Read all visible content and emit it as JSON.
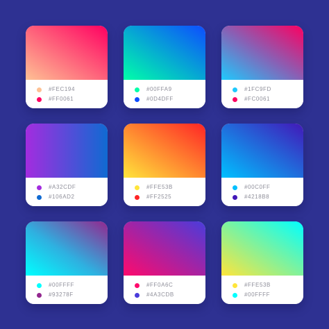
{
  "background": "#2E3192",
  "cards": [
    {
      "colors": [
        {
          "hex": "#FEC194",
          "label": "#FEC194"
        },
        {
          "hex": "#FF0061",
          "label": "#FF0061"
        }
      ],
      "gradient_direction": "top-right to bottom-left"
    },
    {
      "colors": [
        {
          "hex": "#00FFA9",
          "label": "#00FFA9"
        },
        {
          "hex": "#0D4DFF",
          "label": "#0D4DFF"
        }
      ],
      "gradient_direction": "bottom-left to top-right"
    },
    {
      "colors": [
        {
          "hex": "#1FC9FD",
          "label": "#1FC9FD"
        },
        {
          "hex": "#FC0061",
          "label": "#FC0061"
        }
      ],
      "gradient_direction": "bottom-left to top-right"
    },
    {
      "colors": [
        {
          "hex": "#A32CDF",
          "label": "#A32CDF"
        },
        {
          "hex": "#106AD2",
          "label": "#106AD2"
        }
      ],
      "gradient_direction": "left to right"
    },
    {
      "colors": [
        {
          "hex": "#FFE53B",
          "label": "#FFE53B"
        },
        {
          "hex": "#FF2525",
          "label": "#FF2525"
        }
      ],
      "gradient_direction": "bottom-left to top-right"
    },
    {
      "colors": [
        {
          "hex": "#00C0FF",
          "label": "#00C0FF"
        },
        {
          "hex": "#4218B8",
          "label": "#4218B8"
        }
      ],
      "gradient_direction": "bottom-left to top-right"
    },
    {
      "colors": [
        {
          "hex": "#00FFFF",
          "label": "#00FFFF"
        },
        {
          "hex": "#93278F",
          "label": "#93278F"
        }
      ],
      "gradient_direction": "bottom-left to top-right"
    },
    {
      "colors": [
        {
          "hex": "#FF0A6C",
          "label": "#FF0A6C"
        },
        {
          "hex": "#4A3CDB",
          "label": "#4A3CDB"
        }
      ],
      "gradient_direction": "bottom-left to top-right"
    },
    {
      "colors": [
        {
          "hex": "#FFE53B",
          "label": "#FFE53B"
        },
        {
          "hex": "#00FFFF",
          "label": "#00FFFF"
        }
      ],
      "gradient_direction": "bottom-left to top-right"
    }
  ]
}
